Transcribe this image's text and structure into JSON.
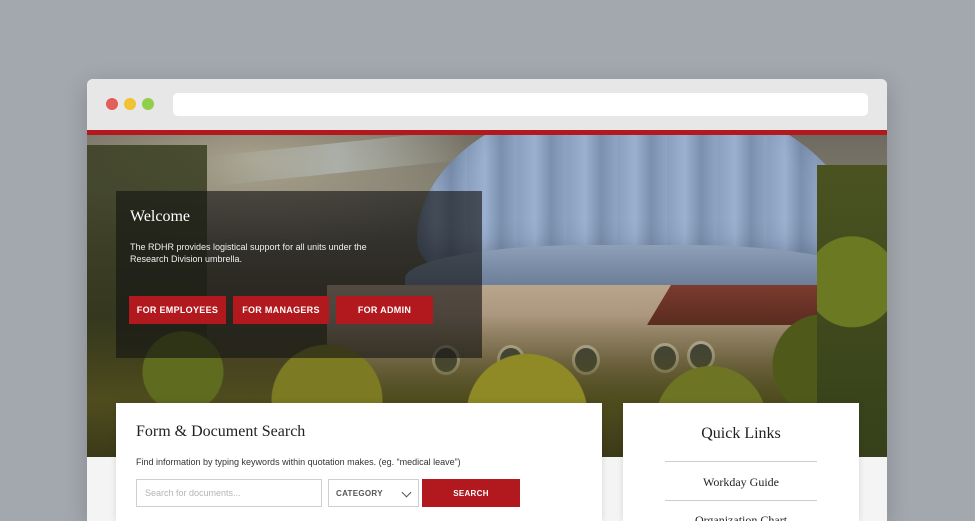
{
  "welcome": {
    "title": "Welcome",
    "text": "The RDHR provides logistical support for all units under the Research Division umbrella.",
    "buttons": [
      "FOR EMPLOYEES",
      "FOR MANAGERS",
      "FOR ADMIN"
    ]
  },
  "search": {
    "title": "Form & Document Search",
    "help": "Find information by typing keywords within quotation makes. (eg. “medical leave”)",
    "placeholder": "Search for documents...",
    "category_label": "CATEGORY",
    "button_label": "SEARCH"
  },
  "quick_links": {
    "title": "Quick Links",
    "items": [
      "Workday Guide",
      "Organization Chart"
    ]
  },
  "colors": {
    "accent": "#b2191e",
    "background": "#a3a7ae"
  },
  "icons": [
    "chevron-down-icon"
  ]
}
